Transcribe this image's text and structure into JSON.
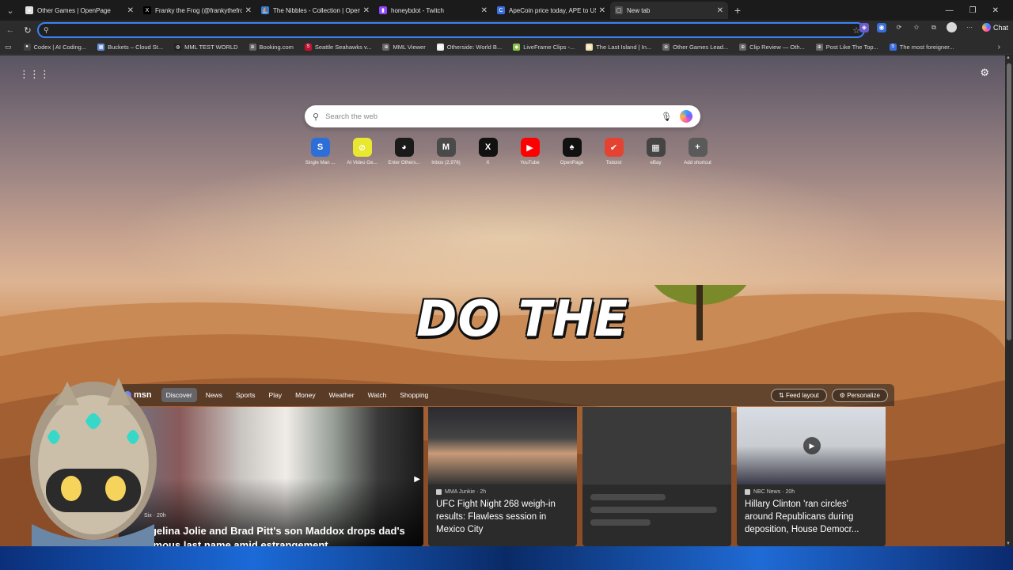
{
  "tabs": [
    {
      "title": "Other Games | OpenPage",
      "icon": "openpage-icon",
      "color": "#e0e0e0",
      "glyph": "♠"
    },
    {
      "title": "Franky the Frog (@frankythefrog)",
      "icon": "x-icon",
      "color": "#000000",
      "glyph": "X"
    },
    {
      "title": "The Nibbles - Collection | OpenSea",
      "icon": "opensea-icon",
      "color": "#2081e2",
      "glyph": "⛵"
    },
    {
      "title": "honeybdot - Twitch",
      "icon": "twitch-icon",
      "color": "#9146ff",
      "glyph": "▮"
    },
    {
      "title": "ApeCoin price today, APE to USD",
      "icon": "coin-icon",
      "color": "#3b6fe0",
      "glyph": "C"
    },
    {
      "title": "New tab",
      "icon": "newtab-icon",
      "color": "#555555",
      "glyph": "▢"
    }
  ],
  "toolbar": {
    "address_value": "",
    "chat_label": "Chat"
  },
  "bookmarks": [
    {
      "label": "Codex | AI Coding...",
      "color": "#444444",
      "glyph": "●"
    },
    {
      "label": "Buckets – Cloud St...",
      "color": "#6b8fd6",
      "glyph": "▦"
    },
    {
      "label": "MML TEST WORLD",
      "color": "#222222",
      "glyph": "◍"
    },
    {
      "label": "Booking.com",
      "color": "#666666",
      "glyph": "⊕"
    },
    {
      "label": "Seattle Seahawks v...",
      "color": "#c4122f",
      "glyph": "S"
    },
    {
      "label": "MML Viewer",
      "color": "#666666",
      "glyph": "⊕"
    },
    {
      "label": "Otherside: World B...",
      "color": "#eeeeee",
      "glyph": "▣"
    },
    {
      "label": "LiveFrame Clips -...",
      "color": "#8bc34a",
      "glyph": "◆"
    },
    {
      "label": "The Last Island | In...",
      "color": "#f0e0b0",
      "glyph": "▤"
    },
    {
      "label": "Other Games Lead...",
      "color": "#666666",
      "glyph": "⊕"
    },
    {
      "label": "Clip Review — Oth...",
      "color": "#666666",
      "glyph": "⊕"
    },
    {
      "label": "Post Like The Top...",
      "color": "#666666",
      "glyph": "⊕"
    },
    {
      "label": "The most foreigner...",
      "color": "#3b6fe0",
      "glyph": "S"
    }
  ],
  "ntp": {
    "search_placeholder": "Search the web",
    "quicklinks": [
      {
        "label": "Single Man ...",
        "bg": "#2d6fd6",
        "glyph": "S"
      },
      {
        "label": "AI Video Ge...",
        "bg": "#e8e830",
        "glyph": "⊘"
      },
      {
        "label": "Enter Others...",
        "bg": "#1a1a1a",
        "glyph": "◕"
      },
      {
        "label": "Inbox (2,976)",
        "bg": "#4a4a4a",
        "glyph": "M"
      },
      {
        "label": "X",
        "bg": "#111111",
        "glyph": "X"
      },
      {
        "label": "YouTube",
        "bg": "#ff0000",
        "glyph": "▶"
      },
      {
        "label": "OpenPage",
        "bg": "#111111",
        "glyph": "♠"
      },
      {
        "label": "Todoist",
        "bg": "#e44332",
        "glyph": "✔"
      },
      {
        "label": "eBay",
        "bg": "#444444",
        "glyph": "▦"
      },
      {
        "label": "Add shortcut",
        "bg": "#5a5a5a",
        "glyph": "+"
      }
    ],
    "overlay_caption": "DO THE"
  },
  "feed": {
    "brand": "msn",
    "tabs": [
      "Discover",
      "News",
      "Sports",
      "Play",
      "Money",
      "Weather",
      "Watch",
      "Shopping"
    ],
    "feed_layout_label": "Feed layout",
    "personalize_label": "Personalize",
    "hero": {
      "source": "Six · 20h",
      "headline": "ngelina Jolie and Brad Pitt's son Maddox drops dad's famous last name amid estrangement"
    },
    "cards": [
      {
        "source": "MMA Junkie · 2h",
        "headline": "UFC Fight Night 268 weigh-in results: Flawless session in Mexico City"
      },
      {
        "source": "",
        "headline": ""
      },
      {
        "source": "NBC News · 20h",
        "headline": "Hillary Clinton 'ran circles' around Republicans during deposition, House Democr..."
      }
    ]
  },
  "colors": {
    "accent": "#3b82f6",
    "chrome_bg": "#2c2c2c",
    "tabstrip_bg": "#1b1b1b"
  }
}
